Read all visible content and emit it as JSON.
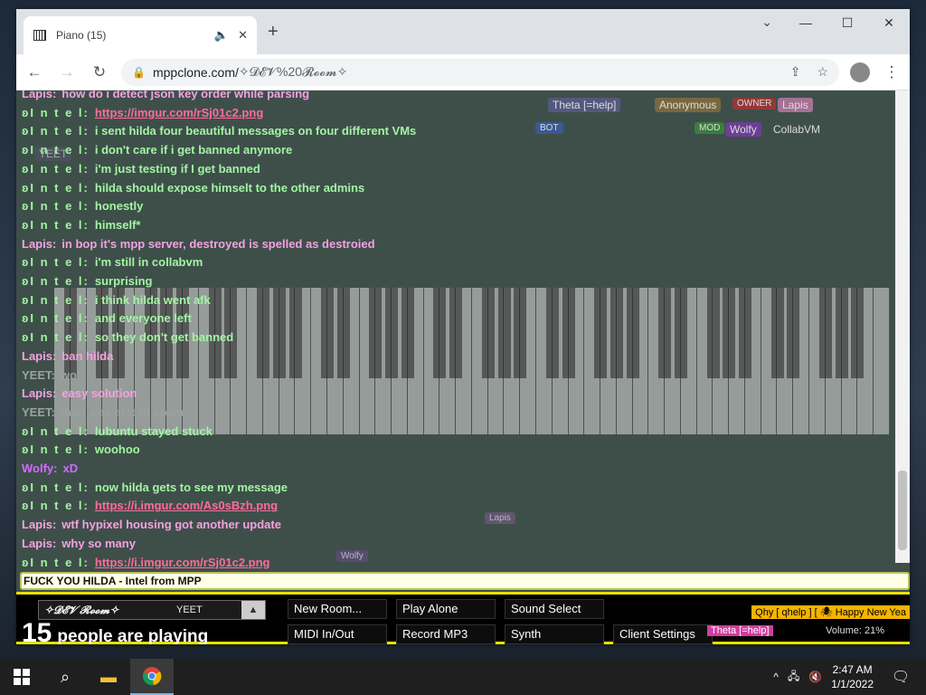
{
  "browser": {
    "tab_title": "Piano (15)",
    "url_host": "mppclone.com/",
    "url_path": "✧𝓓𝓔𝓥%20𝓡𝓸𝓸𝓶✧"
  },
  "chat": {
    "messages": [
      {
        "nick": "Lapis:",
        "text": "how do i detect json key order while parsing",
        "who": "lapis"
      },
      {
        "nick": "ʚI n t e l:",
        "text": "https://imgur.com/rSj01c2.png",
        "who": "intel",
        "link": true
      },
      {
        "nick": "ʚI n t e l:",
        "text": "i sent hilda four beautiful messages on four different VMs",
        "who": "intel"
      },
      {
        "nick": "ʚI n t e l:",
        "text": "i don't care if i get banned anymore",
        "who": "intel"
      },
      {
        "nick": "ʚI n t e l:",
        "text": "i'm just testing if I get banned",
        "who": "intel"
      },
      {
        "nick": "ʚI n t e l:",
        "text": "hilda should expose himselt to the other admins",
        "who": "intel"
      },
      {
        "nick": "ʚI n t e l:",
        "text": "honestly",
        "who": "intel"
      },
      {
        "nick": "ʚI n t e l:",
        "text": "himself*",
        "who": "intel"
      },
      {
        "nick": "Lapis:",
        "text": "in bop it's mpp server, destroyed is spelled as destroied",
        "who": "lapis"
      },
      {
        "nick": "ʚI n t e l:",
        "text": "i'm still in collabvm",
        "who": "intel"
      },
      {
        "nick": "ʚI n t e l:",
        "text": "surprising",
        "who": "intel"
      },
      {
        "nick": "ʚI n t e l:",
        "text": "i think hilda went afk",
        "who": "intel"
      },
      {
        "nick": "ʚI n t e l:",
        "text": "and everyone left",
        "who": "intel"
      },
      {
        "nick": "ʚI n t e l:",
        "text": "so they don't get banned",
        "who": "intel"
      },
      {
        "nick": "Lapis:",
        "text": "ban hilda",
        "who": "lapis"
      },
      {
        "nick": "YEET:",
        "text": "wo",
        "who": "yeet"
      },
      {
        "nick": "Lapis:",
        "text": "easy solution",
        "who": "lapis"
      },
      {
        "nick": "YEET:",
        "text": "their was alot of spam",
        "who": "yeet"
      },
      {
        "nick": "ʚI n t e l:",
        "text": "lubuntu stayed stuck",
        "who": "intel"
      },
      {
        "nick": "ʚI n t e l:",
        "text": "woohoo",
        "who": "intel"
      },
      {
        "nick": "Wolfy:",
        "text": "xD",
        "who": "wolfy"
      },
      {
        "nick": "ʚI n t e l:",
        "text": "now hilda gets to see my message",
        "who": "intel"
      },
      {
        "nick": "ʚI n t e l:",
        "text": "https://i.imgur.com/As0sBzh.png",
        "who": "intel",
        "link": true
      },
      {
        "nick": "Lapis:",
        "text": "wtf hypixel housing got another update",
        "who": "lapis"
      },
      {
        "nick": "Lapis:",
        "text": "why so many",
        "who": "lapis"
      },
      {
        "nick": "ʚI n t e l:",
        "text": "https://i.imgur.com/rSj01c2.png",
        "who": "intel",
        "link": true
      }
    ],
    "input_value": "FUCK YOU HILDA - Intel from MPP"
  },
  "badges": {
    "theta": "Theta [=help]",
    "anonymous": "Anonymous",
    "owner": "OWNER",
    "lapis": "Lapis",
    "mod": "MOD",
    "wolfy": "Wolfy",
    "collabvm": "CollabVM",
    "bot": "BOT",
    "yeet": "YEET",
    "cursor_lapis": "Lapis",
    "cursor_wolfy": "Wolfy"
  },
  "bottom": {
    "room_name": "✧𝓓𝓔𝓥 𝓡𝓸𝓸𝓶✧",
    "room_user": "YEET",
    "count": "15",
    "count_text": "people are playing",
    "buttons": {
      "new_room": "New Room...",
      "play_alone": "Play Alone",
      "sound_select": "Sound Select",
      "midi": "MIDI In/Out",
      "record": "Record MP3",
      "synth": "Synth",
      "client_settings": "Client Settings"
    },
    "theta_tag": "Theta [=help]",
    "ticker": "Qhy [ qhelp ] [ 🕷 Happy New Yea",
    "volume": "Volume: 21%"
  },
  "taskbar": {
    "time": "2:47 AM",
    "date": "1/1/2022"
  }
}
